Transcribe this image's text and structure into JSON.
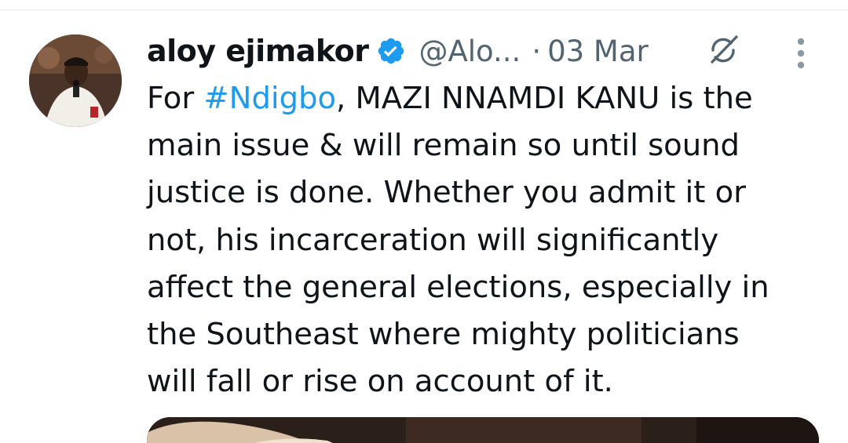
{
  "author": {
    "display_name": "aloy ejimakor",
    "handle": "@Alo...",
    "separator": "·",
    "timestamp": "03 Mar"
  },
  "icons": {
    "verified": "verified-badge-icon",
    "grok": "grok-icon",
    "more": "more-options-icon"
  },
  "colors": {
    "hashtag": "#1d9bf0",
    "secondary_text": "#536471",
    "verified": "#1d9bf0"
  },
  "tweet": {
    "line1_prefix": "For ",
    "hashtag": "#Ndigbo",
    "line1_suffix": ", MAZI NNAMDI KANU is the",
    "line2": "main issue & will remain so until sound",
    "line3": "justice is done. Whether you admit it or",
    "line4": "not, his incarceration will significantly",
    "line5": "affect the general elections, especially in",
    "line6": "the Southeast where mighty politicians",
    "line7": "will fall or rise on account of it."
  }
}
